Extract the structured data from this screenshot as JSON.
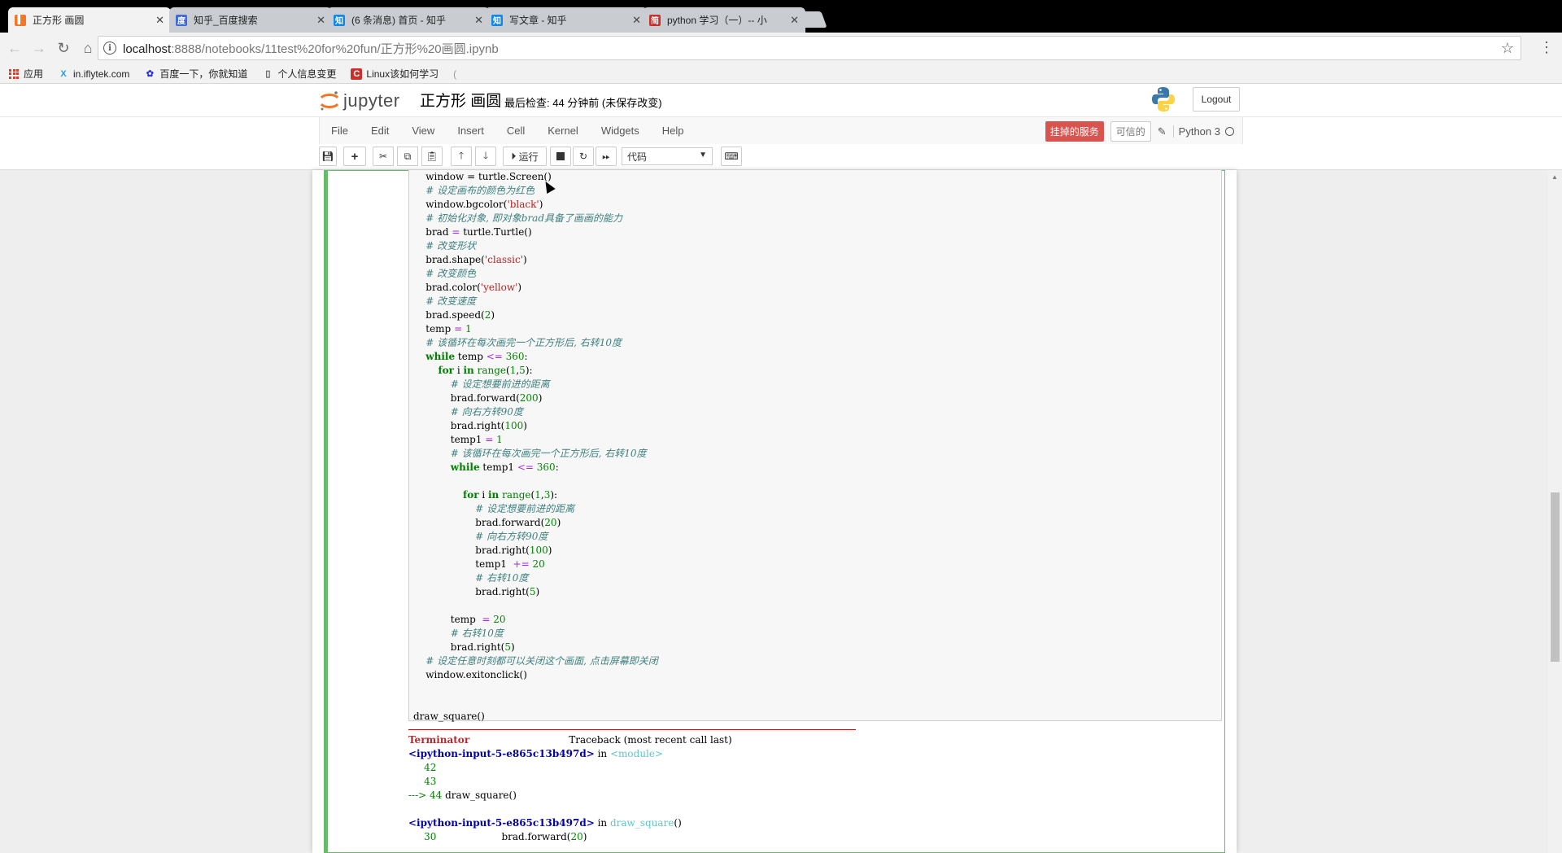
{
  "browser": {
    "tabs": [
      {
        "title": "正方形 画圆",
        "favicon": "notebook-icon",
        "active": true
      },
      {
        "title": "知乎_百度搜索",
        "favicon": "baidu-icon",
        "active": false
      },
      {
        "title": "(6 条消息) 首页 - 知乎",
        "favicon": "zhihu-icon",
        "active": false
      },
      {
        "title": "写文章 - 知乎",
        "favicon": "zhihu-icon",
        "active": false
      },
      {
        "title": "python 学习（一）-- 小",
        "favicon": "csdn-icon",
        "active": false
      }
    ],
    "url_host": "localhost",
    "url_rest": ":8888/notebooks/11test%20for%20fun/正方形%20画圆.ipynb",
    "bookmarks": [
      {
        "label": "应用",
        "icon": "apps-icon"
      },
      {
        "label": "in.iflytek.com",
        "icon": "iflytek-icon"
      },
      {
        "label": "百度一下，你就知道",
        "icon": "baidu-paw-icon"
      },
      {
        "label": "个人信息变更",
        "icon": "page-icon"
      },
      {
        "label": "Linux该如何学习",
        "icon": "csdn-c-icon"
      },
      {
        "label": "(",
        "icon": ""
      }
    ]
  },
  "jupyter": {
    "logo_text": "jupyter",
    "notebook_name": "正方形 画圆",
    "checkpoint": "最后检查: 44 分钟前  (未保存改变)",
    "logout": "Logout",
    "menu": [
      "File",
      "Edit",
      "View",
      "Insert",
      "Cell",
      "Kernel",
      "Widgets",
      "Help"
    ],
    "kernel_dead": "挂掉的服务",
    "trusted": "可信的",
    "kernel_name": "Python 3",
    "run_label": "运行",
    "cell_type": "代码"
  },
  "colors": {
    "accent_green": "#66bb6a",
    "dead_red": "#d9534f"
  }
}
